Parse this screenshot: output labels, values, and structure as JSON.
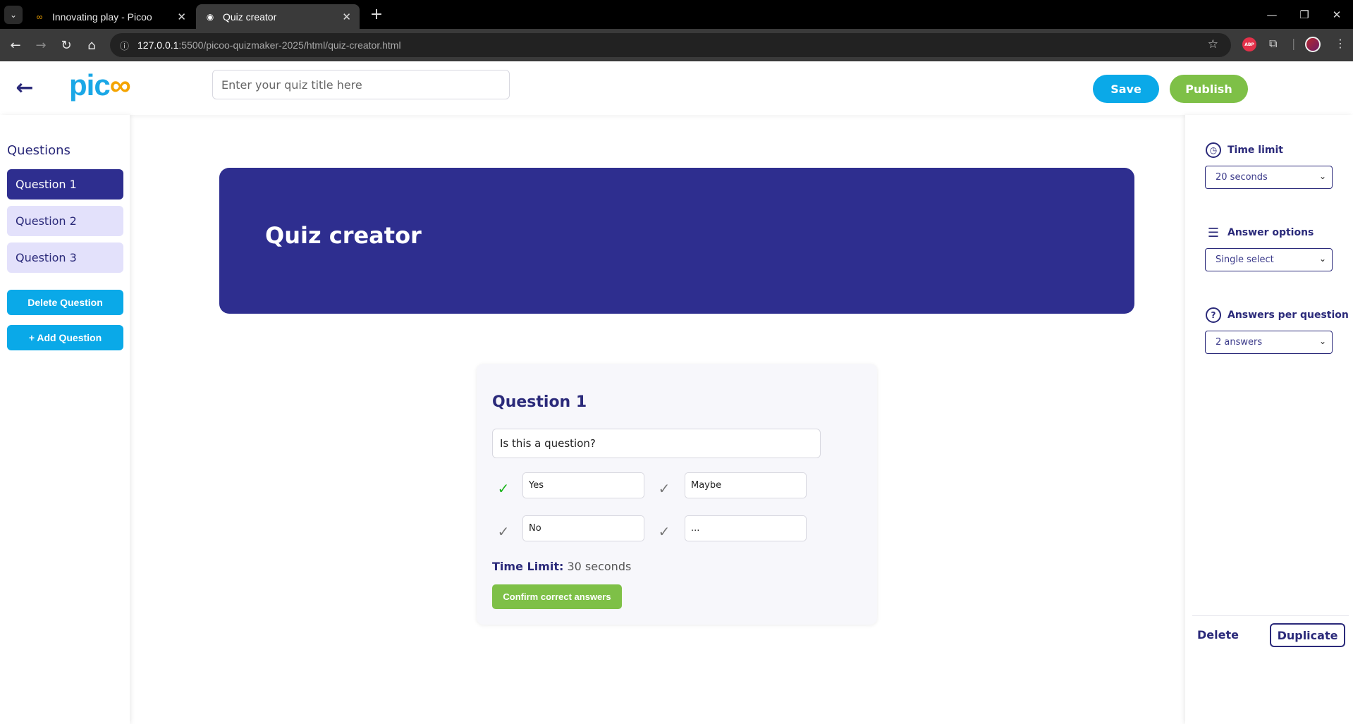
{
  "browser": {
    "tabs": [
      {
        "title": "Innovating play - Picoo",
        "favicon": "infinity-icon"
      },
      {
        "title": "Quiz creator",
        "favicon": "globe-icon"
      }
    ],
    "url": {
      "host": "127.0.0.1",
      "path": ":5500/picoo-quizmaker-2025/html/quiz-creator.html"
    },
    "extension_abp": "ABP"
  },
  "header": {
    "logo_text": "pic",
    "logo_suffix": "∞",
    "title_placeholder": "Enter your quiz title here",
    "save_label": "Save",
    "publish_label": "Publish"
  },
  "sidebar": {
    "heading": "Questions",
    "items": [
      {
        "label": "Question 1",
        "active": true
      },
      {
        "label": "Question 2",
        "active": false
      },
      {
        "label": "Question 3",
        "active": false
      }
    ],
    "delete_label": "Delete Question",
    "add_label": "+ Add Question"
  },
  "banner": {
    "title": "Quiz creator"
  },
  "card": {
    "title": "Question 1",
    "question_value": "Is this a question?",
    "answers": [
      {
        "value": "Yes",
        "correct": true
      },
      {
        "value": "Maybe",
        "correct": false
      },
      {
        "value": "No",
        "correct": false
      },
      {
        "value": "...",
        "correct": false
      }
    ],
    "time_label": "Time Limit:",
    "time_value": "30 seconds",
    "confirm_label": "Confirm correct answers"
  },
  "settings": {
    "time_limit": {
      "label": "Time limit",
      "selected": "20 seconds"
    },
    "answer_options": {
      "label": "Answer options",
      "selected": "Single select"
    },
    "answers_per_question": {
      "label": "Answers per question",
      "selected": "2 answers"
    },
    "delete_label": "Delete",
    "duplicate_label": "Duplicate"
  },
  "colors": {
    "brand_navy": "#2e2e8f",
    "brand_blue": "#0aa9e8",
    "brand_green": "#7ec047",
    "correct_check": "#1db41d"
  }
}
